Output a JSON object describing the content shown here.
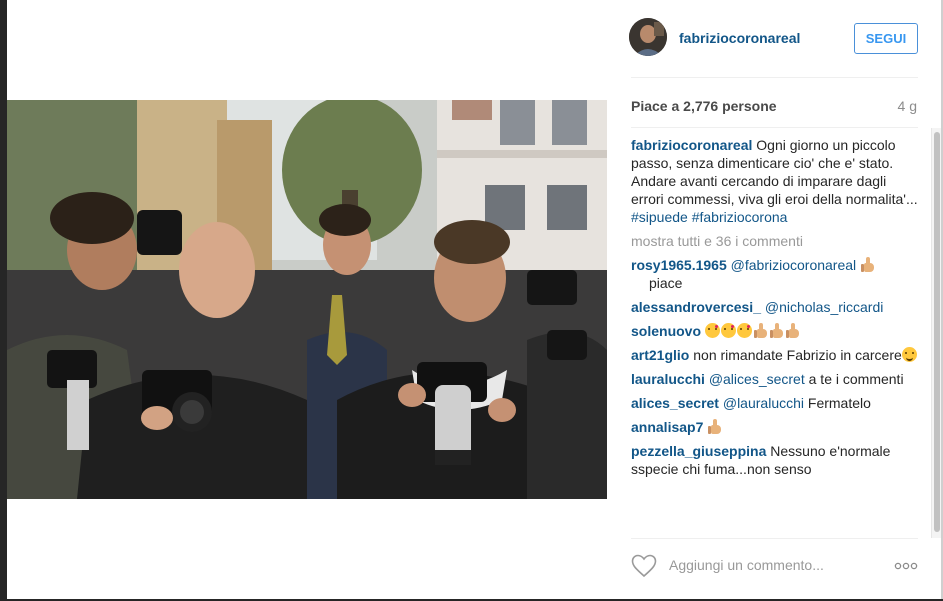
{
  "post": {
    "username": "fabriziocoronareal",
    "follow_label": "SEGUI",
    "likes_text": "Piace a 2,776 persone",
    "time_ago": "4 g",
    "caption": {
      "user": "fabriziocoronareal",
      "text": " Ogni giorno un piccolo passo, senza dimenticare cio' che e' stato. Andare avanti cercando di imparare dagli errori commessi, viva gli eroi della normalita'... ",
      "tag1": "#sipuede",
      "tag2": "#fabriziocorona"
    },
    "show_all_comments": "mostra tutti e 36 i commenti",
    "comments": [
      {
        "user": "rosy1965.1965",
        "mention": "@fabriziocoronareal",
        "text": "piace"
      },
      {
        "user": "alessandrovercesi_",
        "mention": "@nicholas_riccardi",
        "text": ""
      },
      {
        "user": "solenuovo",
        "mention": "",
        "text": ""
      },
      {
        "user": "art21glio",
        "mention": "",
        "text": " non rimandate Fabrizio in carcere"
      },
      {
        "user": "lauralucchi",
        "mention": "@alices_secret",
        "text": " a te i commenti"
      },
      {
        "user": "alices_secret",
        "mention": "@lauralucchi",
        "text": " Fermatelo"
      },
      {
        "user": "annalisap7",
        "mention": "",
        "text": ""
      },
      {
        "user": "pezzella_giuseppina",
        "mention": "",
        "text": " Nessuno e'normale sspecie chi fuma...non senso"
      }
    ],
    "comment_placeholder": "Aggiungi un commento...",
    "icons": {
      "heart": "heart-outline-icon",
      "more": "more-options-icon",
      "thumbs_up": "thumbs-up-emoji",
      "kiss": "face-blowing-kiss-emoji",
      "grin": "grinning-face-emoji"
    },
    "colors": {
      "username": "#125688",
      "follow_border": "#4a90d9",
      "follow_text": "#3897f0",
      "muted": "#999999"
    }
  }
}
